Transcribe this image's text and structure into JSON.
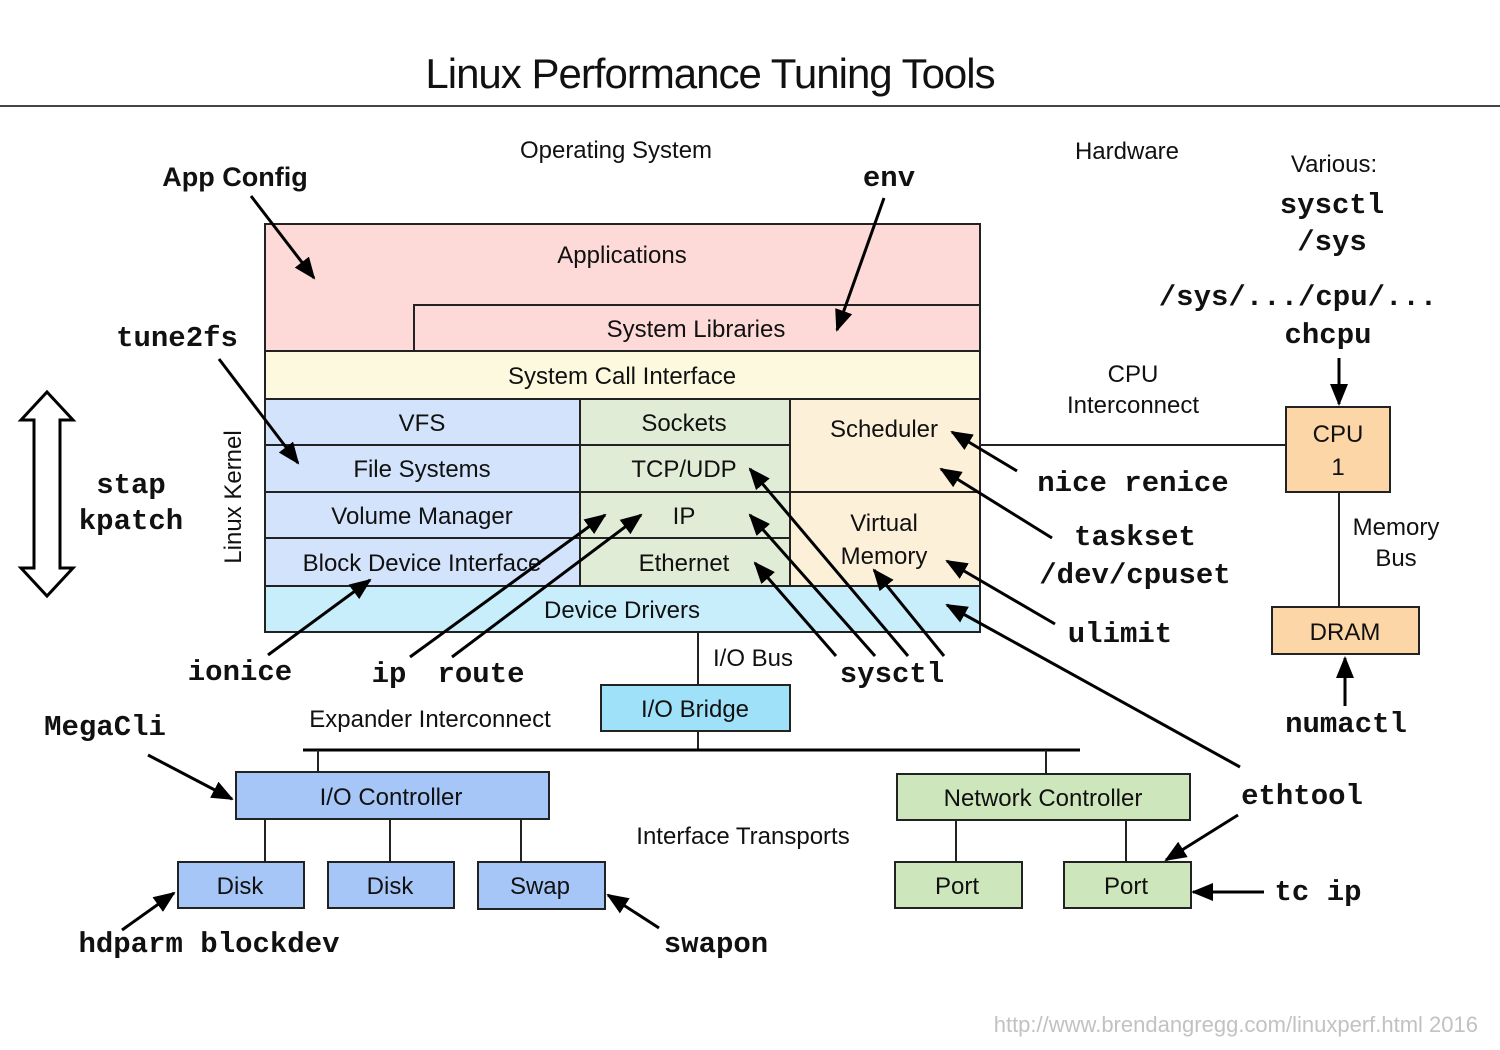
{
  "title": "Linux Performance Tuning Tools",
  "sections": {
    "operating_system": "Operating System",
    "hardware": "Hardware",
    "linux_kernel": "Linux Kernel",
    "various": "Various:"
  },
  "colors": {
    "applications": "#fdd9d8",
    "syscall": "#fdf9df",
    "filesystem": "#d3e3fb",
    "network": "#e0ecd6",
    "scheduler": "#fdf0d9",
    "drivers": "#c8eefc",
    "io_bridge": "#9fe1f8",
    "io_controller": "#a6c6f8",
    "net_controller": "#cde6bb",
    "cpu": "#fcd6a6"
  },
  "stack": {
    "applications": "Applications",
    "system_libraries": "System Libraries",
    "system_call_interface": "System Call Interface",
    "vfs": "VFS",
    "file_systems": "File Systems",
    "volume_manager": "Volume Manager",
    "block_device_interface": "Block Device Interface",
    "sockets": "Sockets",
    "tcp_udp": "TCP/UDP",
    "ip": "IP",
    "ethernet": "Ethernet",
    "scheduler": "Scheduler",
    "virtual_memory_line1": "Virtual",
    "virtual_memory_line2": "Memory",
    "device_drivers": "Device Drivers"
  },
  "hardware": {
    "io_bus": "I/O Bus",
    "io_bridge": "I/O Bridge",
    "expander_interconnect": "Expander Interconnect",
    "io_controller": "I/O Controller",
    "disk1": "Disk",
    "disk2": "Disk",
    "swap": "Swap",
    "interface_transports": "Interface Transports",
    "network_controller": "Network Controller",
    "port1": "Port",
    "port2": "Port",
    "cpu_interconnect_line1": "CPU",
    "cpu_interconnect_line2": "Interconnect",
    "cpu_line1": "CPU",
    "cpu_line2": "1",
    "memory_bus_line1": "Memory",
    "memory_bus_line2": "Bus",
    "dram": "DRAM"
  },
  "tools": {
    "app_config": "App Config",
    "env": "env",
    "tune2fs": "tune2fs",
    "stap": "stap",
    "kpatch": "kpatch",
    "ionice": "ionice",
    "ip": "ip",
    "route": "route",
    "sysctl": "sysctl",
    "nice_renice": "nice renice",
    "taskset": "taskset",
    "dev_cpuset": "/dev/cpuset",
    "ulimit": "ulimit",
    "ethtool": "ethtool",
    "tc_ip": "tc ip",
    "megacli": "MegaCli",
    "hdparm_blockdev": "hdparm blockdev",
    "swapon": "swapon",
    "numactl": "numactl",
    "various_sysctl": "sysctl",
    "various_sys": "/sys",
    "sys_cpu": "/sys/.../cpu/...",
    "chcpu": "chcpu"
  },
  "footer": "http://www.brendangregg.com/linuxperf.html 2016"
}
